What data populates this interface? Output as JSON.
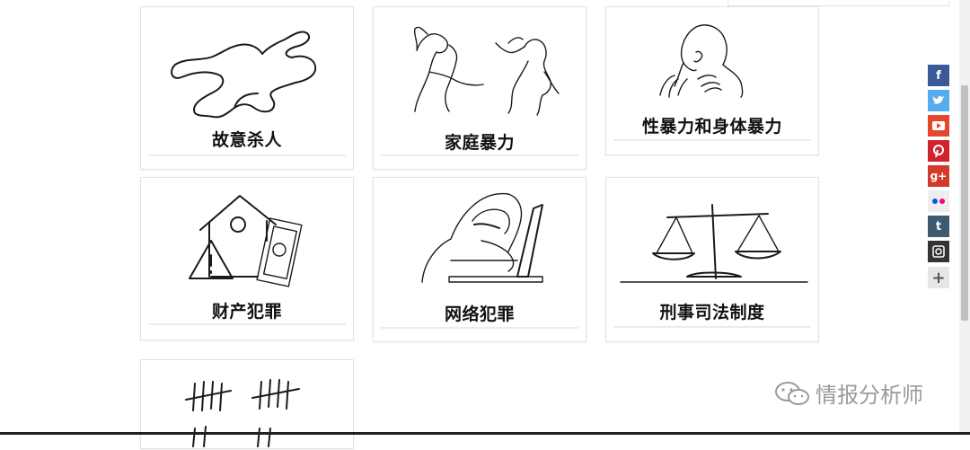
{
  "cards": [
    {
      "title": "故意杀人",
      "icon": "crime-scene-body-outline-icon"
    },
    {
      "title": "家庭暴力",
      "icon": "domestic-violence-icon"
    },
    {
      "title": "性暴力和身体暴力",
      "icon": "sexual-violence-icon"
    },
    {
      "title": "财产犯罪",
      "icon": "property-crime-icon"
    },
    {
      "title": "网络犯罪",
      "icon": "hooded-hacker-icon"
    },
    {
      "title": "刑事司法制度",
      "icon": "scales-of-justice-icon"
    },
    {
      "title": "",
      "icon": "tally-marks-icon"
    }
  ],
  "social": [
    {
      "name": "facebook",
      "glyph": "f",
      "color": "#3b5998"
    },
    {
      "name": "twitter",
      "glyph": "t",
      "color": "#55acee"
    },
    {
      "name": "youtube",
      "glyph": "▶",
      "color": "#e5462e"
    },
    {
      "name": "pinterest",
      "glyph": "p",
      "color": "#d2232c"
    },
    {
      "name": "google-plus",
      "glyph": "g+",
      "color": "#d23b29"
    },
    {
      "name": "flickr",
      "glyph": "●●",
      "color": "#eeeeee"
    },
    {
      "name": "tumblr",
      "glyph": "t",
      "color": "#3d5a70"
    },
    {
      "name": "instagram",
      "glyph": "◘",
      "color": "#333333"
    },
    {
      "name": "more",
      "glyph": "+",
      "color": "#e6e6e6"
    }
  ],
  "watermark": {
    "text": "情报分析师"
  }
}
